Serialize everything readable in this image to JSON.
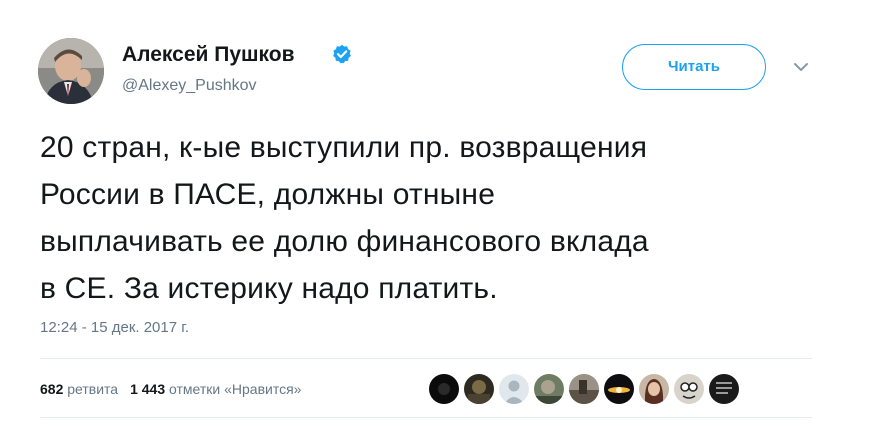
{
  "author": {
    "name": "Алексей Пушков",
    "handle": "@Alexey_Pushkov",
    "verified": true
  },
  "actions": {
    "follow_label": "Читать",
    "more_icon": "chevron-down-icon"
  },
  "tweet": {
    "lines": [
      "20 стран, к-ые выступили пр. возвращения",
      "России в ПАСЕ, должны отныне",
      "выплачивать ее долю финансового вклада",
      "в СЕ. За истерику надо платить."
    ],
    "timestamp": "12:24 - 15 дек. 2017 г."
  },
  "stats": {
    "retweets_count": "682",
    "retweets_label": "ретвита",
    "likes_count": "1 443",
    "likes_label": "отметки «Нравится»"
  },
  "likers_count": 9,
  "colors": {
    "accent": "#1da1f2",
    "text": "#14171a",
    "muted": "#657786",
    "divider": "#e6ecf0"
  }
}
